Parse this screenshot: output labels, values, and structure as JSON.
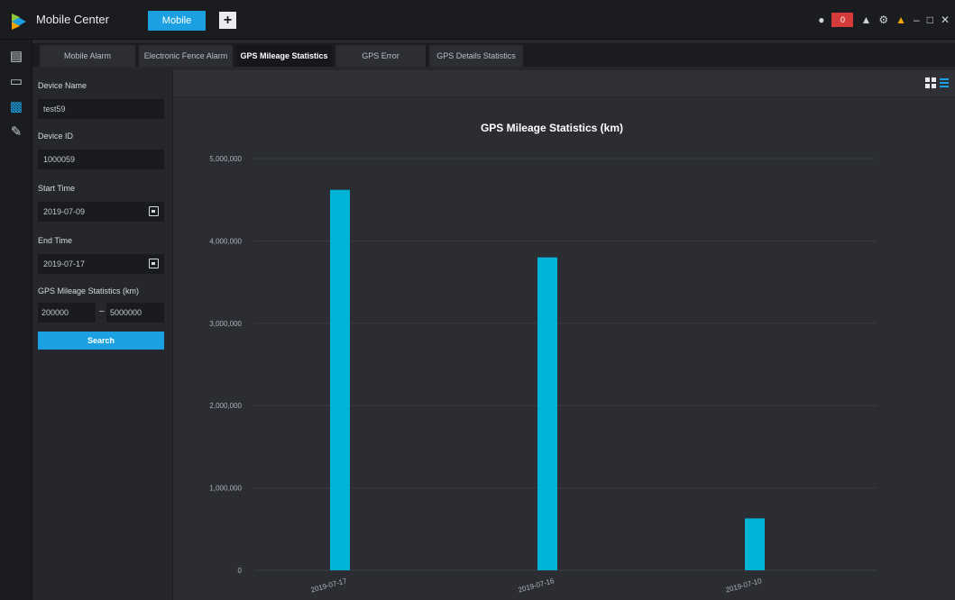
{
  "app": {
    "title": "Mobile Center",
    "mode_button": "Mobile",
    "add_button": "+",
    "alarm_count": "0"
  },
  "tabs": [
    {
      "label": "Mobile Alarm",
      "active": false
    },
    {
      "label": "Electronic Fence Alarm",
      "active": false
    },
    {
      "label": "GPS Mileage Statistics",
      "active": true
    },
    {
      "label": "GPS Error",
      "active": false
    },
    {
      "label": "GPS Details Statistics",
      "active": false
    }
  ],
  "filters": {
    "device_name_label": "Device Name",
    "device_name_value": "test59",
    "device_id_label": "Device ID",
    "device_id_value": "1000059",
    "start_time_label": "Start Time",
    "start_time_value": "2019-07-09",
    "end_time_label": "End Time",
    "end_time_value": "2019-07-17",
    "mileage_label": "GPS Mileage Statistics (km)",
    "mileage_min": "200000",
    "mileage_sep": "–",
    "mileage_max": "5000000",
    "search_button": "Search"
  },
  "colors": {
    "accent": "#1ba1e2",
    "bar": "#00b4d8",
    "alarm": "#d63b3b"
  },
  "chart_data": {
    "type": "bar",
    "title": "GPS Mileage Statistics (km)",
    "categories": [
      "2019-07-17",
      "2019-07-16",
      "2019-07-10"
    ],
    "values": [
      4620000,
      3800000,
      630000
    ],
    "yticks": [
      0,
      1000000,
      2000000,
      3000000,
      4000000,
      5000000
    ],
    "ytick_labels": [
      "0",
      "1,000,000",
      "2,000,000",
      "3,000,000",
      "4,000,000",
      "5,000,000"
    ],
    "ylim": [
      0,
      5000000
    ],
    "grid": true,
    "legend": "none"
  }
}
